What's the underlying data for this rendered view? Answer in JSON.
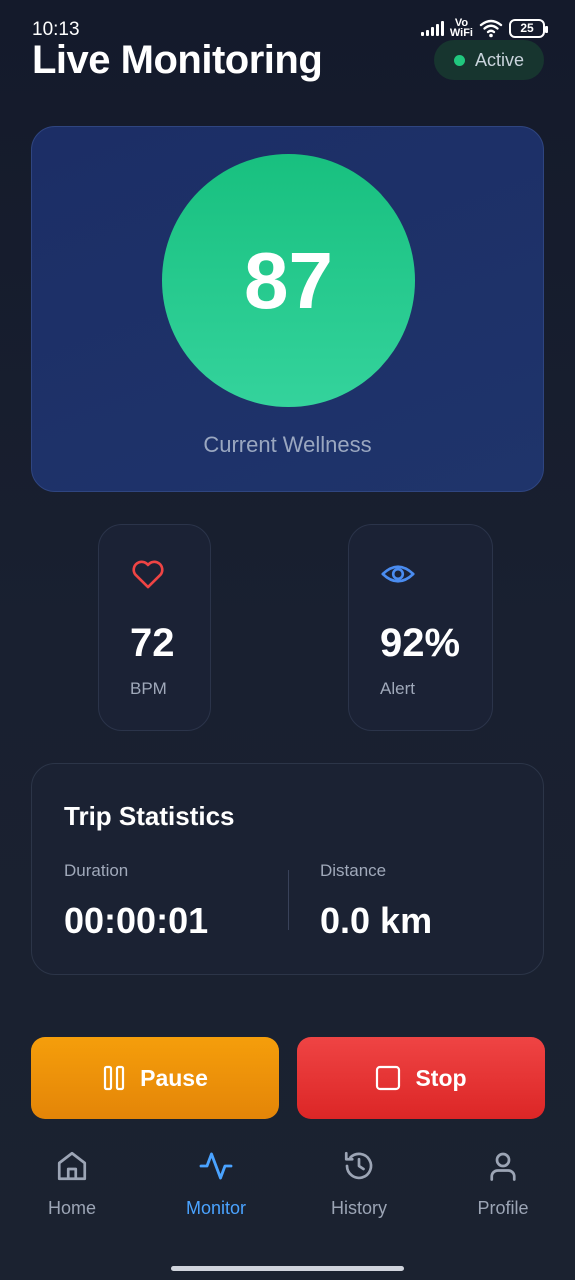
{
  "status_bar": {
    "time": "10:13",
    "network_label_top": "Vo",
    "network_label_bottom": "WiFi",
    "battery": "25"
  },
  "header": {
    "title": "Live Monitoring",
    "status_badge": "Active"
  },
  "wellness": {
    "score": "87",
    "label": "Current Wellness"
  },
  "stats": [
    {
      "icon": "heart-icon",
      "value": "72",
      "label": "BPM"
    },
    {
      "icon": "eye-icon",
      "value": "92%",
      "label": "Alert"
    }
  ],
  "trip": {
    "title": "Trip Statistics",
    "duration_label": "Duration",
    "duration_value": "00:00:01",
    "distance_label": "Distance",
    "distance_value": "0.0 km"
  },
  "actions": {
    "pause_label": "Pause",
    "stop_label": "Stop"
  },
  "nav": {
    "items": [
      {
        "label": "Home",
        "icon": "home-icon"
      },
      {
        "label": "Monitor",
        "icon": "activity-icon",
        "selected": true
      },
      {
        "label": "History",
        "icon": "history-icon"
      },
      {
        "label": "Profile",
        "icon": "user-icon"
      }
    ]
  },
  "colors": {
    "accent_blue": "#4aa3ff",
    "wellness_green": "#1fc889",
    "pause_orange": "#f59e0b",
    "stop_red": "#ef4444",
    "active_green": "#21c77e"
  }
}
